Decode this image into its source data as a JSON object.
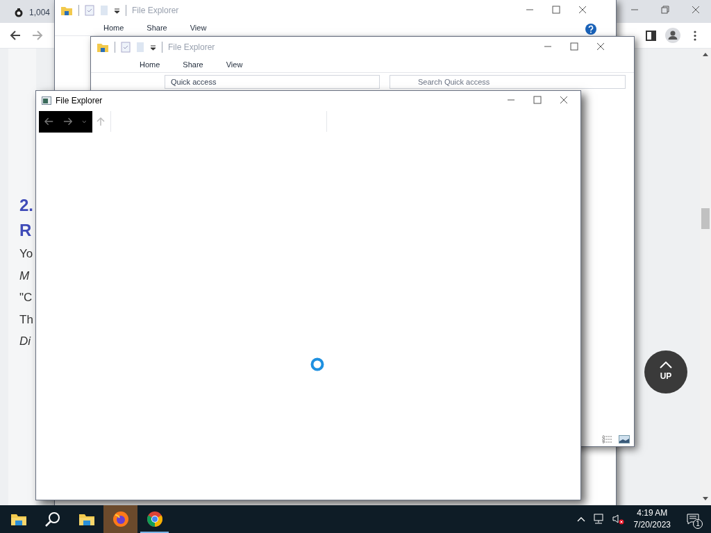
{
  "browser": {
    "tab": {
      "count": "1,004"
    },
    "article": {
      "heading_lines": [
        "2.",
        "R"
      ],
      "body_lines": [
        {
          "text": "Yo",
          "italic": false
        },
        {
          "text": "M",
          "italic": true
        },
        {
          "text": "\"C",
          "italic": false
        },
        {
          "text": "Th",
          "italic": false
        },
        {
          "text": "Di",
          "italic": true
        }
      ]
    },
    "up_button": {
      "label": "UP"
    }
  },
  "back_windows": [
    {
      "title": "File Explorer",
      "ribbon_tabs": [
        "Home",
        "Share",
        "View"
      ]
    },
    {
      "title": "File Explorer",
      "ribbon_tabs": [
        "Home",
        "Share",
        "View"
      ],
      "address": "Quick access",
      "search_placeholder": "Search Quick access"
    }
  ],
  "front_window": {
    "title": "File Explorer",
    "loading": true
  },
  "taskbar": {
    "apps": [
      {
        "kind": "folder",
        "active": false
      },
      {
        "kind": "search",
        "active": false
      },
      {
        "kind": "folder",
        "active": false
      },
      {
        "kind": "firefox",
        "active": true
      },
      {
        "kind": "chrome",
        "active": false,
        "running": true
      }
    ],
    "time": "4:19 AM",
    "date": "7/20/2023",
    "notifications": "1"
  }
}
